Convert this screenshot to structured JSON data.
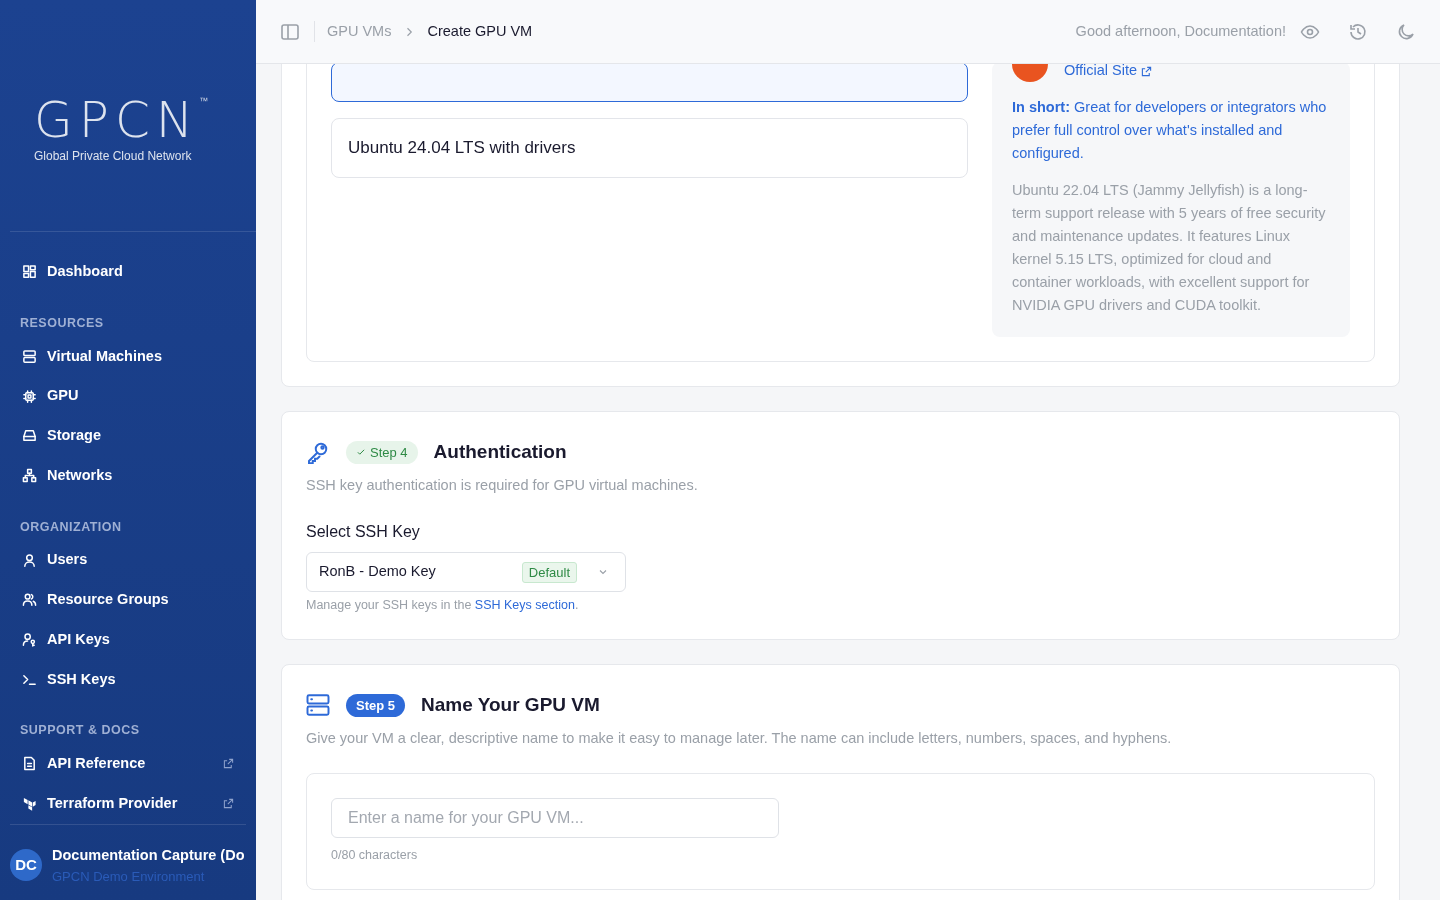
{
  "sidebar": {
    "logo": {
      "wordmark": "GPCN",
      "trademark": "™",
      "tagline": "Global Private Cloud Network"
    },
    "sections": [
      {
        "items": [
          {
            "label": "Dashboard",
            "external": false
          }
        ]
      },
      {
        "heading": "RESOURCES",
        "items": [
          {
            "label": "Virtual Machines",
            "external": false
          },
          {
            "label": "GPU",
            "external": false
          },
          {
            "label": "Storage",
            "external": false
          },
          {
            "label": "Networks",
            "external": false
          }
        ]
      },
      {
        "heading": "ORGANIZATION",
        "items": [
          {
            "label": "Users",
            "external": false
          },
          {
            "label": "Resource Groups",
            "external": false
          },
          {
            "label": "API Keys",
            "external": false
          },
          {
            "label": "SSH Keys",
            "external": false
          }
        ]
      },
      {
        "heading": "SUPPORT & DOCS",
        "items": [
          {
            "label": "API Reference",
            "external": true
          },
          {
            "label": "Terraform Provider",
            "external": true
          }
        ]
      }
    ],
    "user": {
      "initials": "DC",
      "name": "Documentation Capture (Do",
      "subtitle": "GPCN Demo Environment"
    }
  },
  "header": {
    "breadcrumbs": [
      {
        "label": "GPU VMs",
        "current": false
      },
      {
        "label": "Create GPU VM",
        "current": true
      }
    ],
    "greeting": "Good afternoon, Documentation!"
  },
  "os_step": {
    "options": [
      {
        "selected": true
      },
      {
        "label": "Ubuntu 24.04 LTS with drivers",
        "selected": false
      }
    ],
    "info": {
      "link": "Official Site",
      "summary": "**In short:** Great for developers or integrators who prefer full control over what's installed and configured.",
      "description": "Ubuntu 22.04 LTS (Jammy Jellyfish) is a long-term support release with 5 years of free security and maintenance updates. It features Linux kernel 5.15 LTS, optimized for cloud and container workloads, with excellent support for NVIDIA GPU drivers and CUDA toolkit."
    }
  },
  "auth_step": {
    "step": "Step 4",
    "completed": true,
    "title": "Authentication",
    "subtitle": "SSH key authentication is required for GPU virtual machines.",
    "label": "Select SSH Key",
    "value": "RonB - Demo Key",
    "tag": "Default",
    "help": "Manage your SSH keys in the ",
    "help_link": "SSH Keys section",
    "help_end": "."
  },
  "name_step": {
    "step": "Step 5",
    "completed": false,
    "title": "Name Your GPU VM",
    "subtitle": "Give your VM a clear, descriptive name to make it easy to manage later. The name can include letters, numbers, spaces, and hyphens.",
    "placeholder": "Enter a name for your GPU VM...",
    "counter": "0/80 characters"
  }
}
